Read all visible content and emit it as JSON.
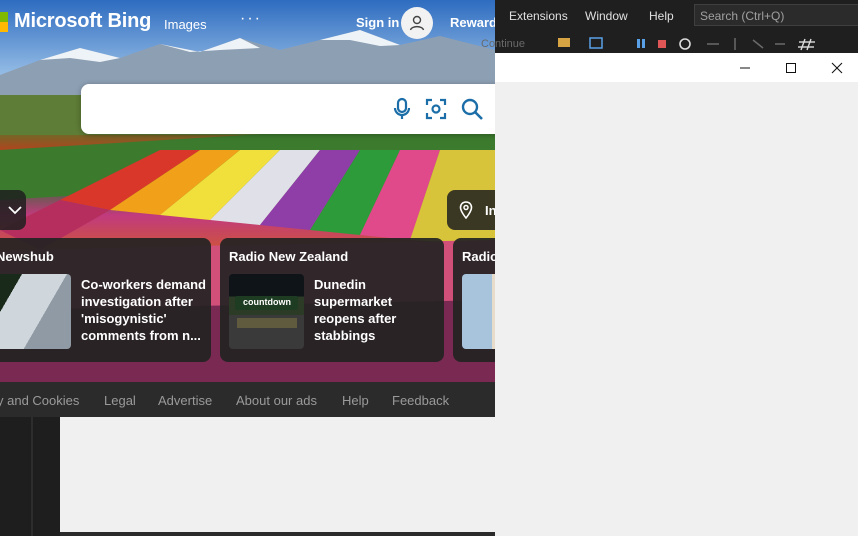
{
  "bing": {
    "brand": "Microsoft Bing",
    "nav": {
      "images": "Images",
      "more": "···",
      "sign_in": "Sign in",
      "rewards": "Rewards"
    },
    "search": {
      "placeholder": ""
    },
    "chip_right_label": "In",
    "news": [
      {
        "source": "Newshub",
        "title": "Co-workers demand investigation after 'misogynistic' comments from n..."
      },
      {
        "source": "Radio New Zealand",
        "title": "Dunedin supermarket reopens after stabbings",
        "thumb_caption": "countdown"
      },
      {
        "source": "Radio"
      }
    ],
    "footer": [
      "y and Cookies",
      "Legal",
      "Advertise",
      "About our ads",
      "Help",
      "Feedback"
    ]
  },
  "vs": {
    "menu": [
      "Extensions",
      "Window",
      "Help"
    ],
    "search_placeholder": "Search (Ctrl+Q)",
    "toolbar_continue": "Continue"
  },
  "window": {
    "minimize": "—",
    "maximize": "☐",
    "close": "✕"
  },
  "colors": {
    "logo_green": "#7fba00",
    "logo_yellow": "#ffb900",
    "bing_icon_blue": "#1b6ea8",
    "vs_bg": "#1f1f1f"
  }
}
